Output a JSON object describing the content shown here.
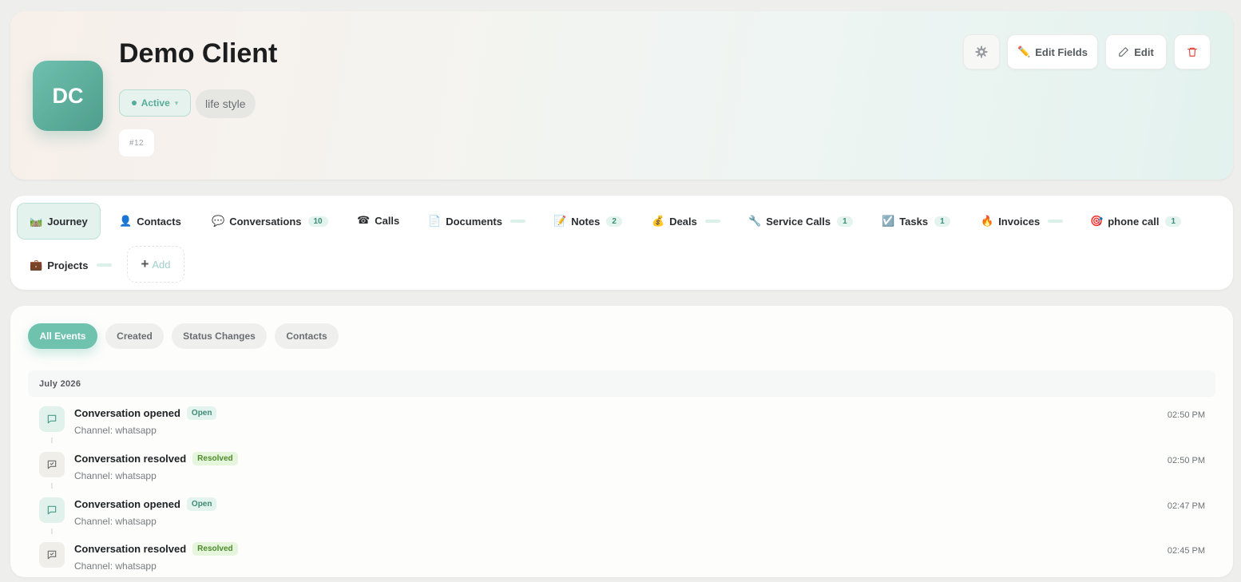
{
  "client": {
    "initials": "DC",
    "name": "Demo Client",
    "status": "Active",
    "tag": "life style",
    "id": "#12"
  },
  "header_buttons": {
    "settings_icon": "gear-icon",
    "edit_fields": "Edit Fields",
    "edit": "Edit",
    "delete_icon": "trash-icon"
  },
  "tabs": [
    {
      "emoji": "🛤️",
      "label": "Journey",
      "badge": null,
      "active": true
    },
    {
      "emoji": "👤",
      "label": "Contacts",
      "badge": null
    },
    {
      "emoji": "💬",
      "label": "Conversations",
      "badge": "10"
    },
    {
      "emoji": "☎",
      "label": "Calls",
      "badge": null
    },
    {
      "emoji": "📄",
      "label": "Documents",
      "badge": ""
    },
    {
      "emoji": "📝",
      "label": "Notes",
      "badge": "2"
    },
    {
      "emoji": "💰",
      "label": "Deals",
      "badge": ""
    },
    {
      "emoji": "🔧",
      "label": "Service Calls",
      "badge": "1"
    },
    {
      "emoji": "☑️",
      "label": "Tasks",
      "badge": "1"
    },
    {
      "emoji": "🔥",
      "label": "Invoices",
      "badge": ""
    },
    {
      "emoji": "🎯",
      "label": "phone call",
      "badge": "1"
    },
    {
      "emoji": "💼",
      "label": "Projects",
      "badge": ""
    }
  ],
  "add_tab_label": "Add",
  "filters": [
    "All Events",
    "Created",
    "Status Changes",
    "Contacts"
  ],
  "month": "July 2026",
  "events": [
    {
      "title": "Conversation opened",
      "badge": "Open",
      "kind": "open",
      "sub": "Channel: whatsapp",
      "time": "02:50 PM"
    },
    {
      "title": "Conversation resolved",
      "badge": "Resolved",
      "kind": "resolved",
      "sub": "Channel: whatsapp",
      "time": "02:50 PM"
    },
    {
      "title": "Conversation opened",
      "badge": "Open",
      "kind": "open",
      "sub": "Channel: whatsapp",
      "time": "02:47 PM"
    },
    {
      "title": "Conversation resolved",
      "badge": "Resolved",
      "kind": "resolved",
      "sub": "Channel: whatsapp",
      "time": "02:45 PM"
    }
  ],
  "colors": {
    "accent": "#6ec2ae",
    "delete": "#e0483c"
  }
}
